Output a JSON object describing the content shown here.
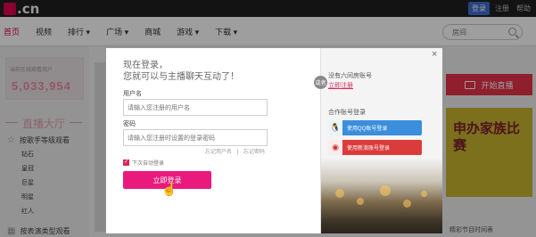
{
  "brand": {
    "logo_text": ".cn"
  },
  "top_actions": {
    "login": "登录",
    "register": "注册",
    "more": "帮助"
  },
  "nav": {
    "items": [
      {
        "label": "首页",
        "active": true
      },
      {
        "label": "视频"
      },
      {
        "label": "排行 ▾"
      },
      {
        "label": "广场 ▾"
      },
      {
        "label": "商城"
      },
      {
        "label": "游戏 ▾"
      },
      {
        "label": "下载 ▾"
      }
    ],
    "search_placeholder": "房间"
  },
  "left": {
    "counter_label": "当前在线观看用户",
    "counter_value": "5,033,954",
    "hall_title": "直播大厅",
    "sort_by_grade": "按歌手等级观看",
    "grades": [
      {
        "name": "钻石",
        "count": ""
      },
      {
        "name": "皇冠",
        "count": ""
      },
      {
        "name": "巨星",
        "count": ""
      },
      {
        "name": "明星",
        "count": ""
      },
      {
        "name": "红人",
        "count": ""
      }
    ],
    "sort_by_type": "按表演类型观看"
  },
  "right": {
    "start_live": "开始直播",
    "promo_text": "申办家族比赛",
    "schedule": "精彩节目时间表"
  },
  "modal": {
    "headline_line1": "现在登录，",
    "headline_line2": "您就可以与主播聊天互动了！",
    "username_label": "用户名",
    "username_placeholder": "请输入您注册的用户名",
    "password_label": "密码",
    "password_placeholder": "请输入您注册时设置的登录密码",
    "forgot_username": "忘记用户名",
    "separator": "|",
    "forgot_password": "忘记密码",
    "remember_me": "下次自动登录",
    "submit": "立即登录",
    "or_badge": "或者",
    "no_account": "没有六间房账号",
    "register_now": "立即注册",
    "partner_title": "合作账号登录",
    "qq_login": "使用QQ账号登录",
    "weibo_login": "使用新浪账号登录",
    "close": "×"
  }
}
